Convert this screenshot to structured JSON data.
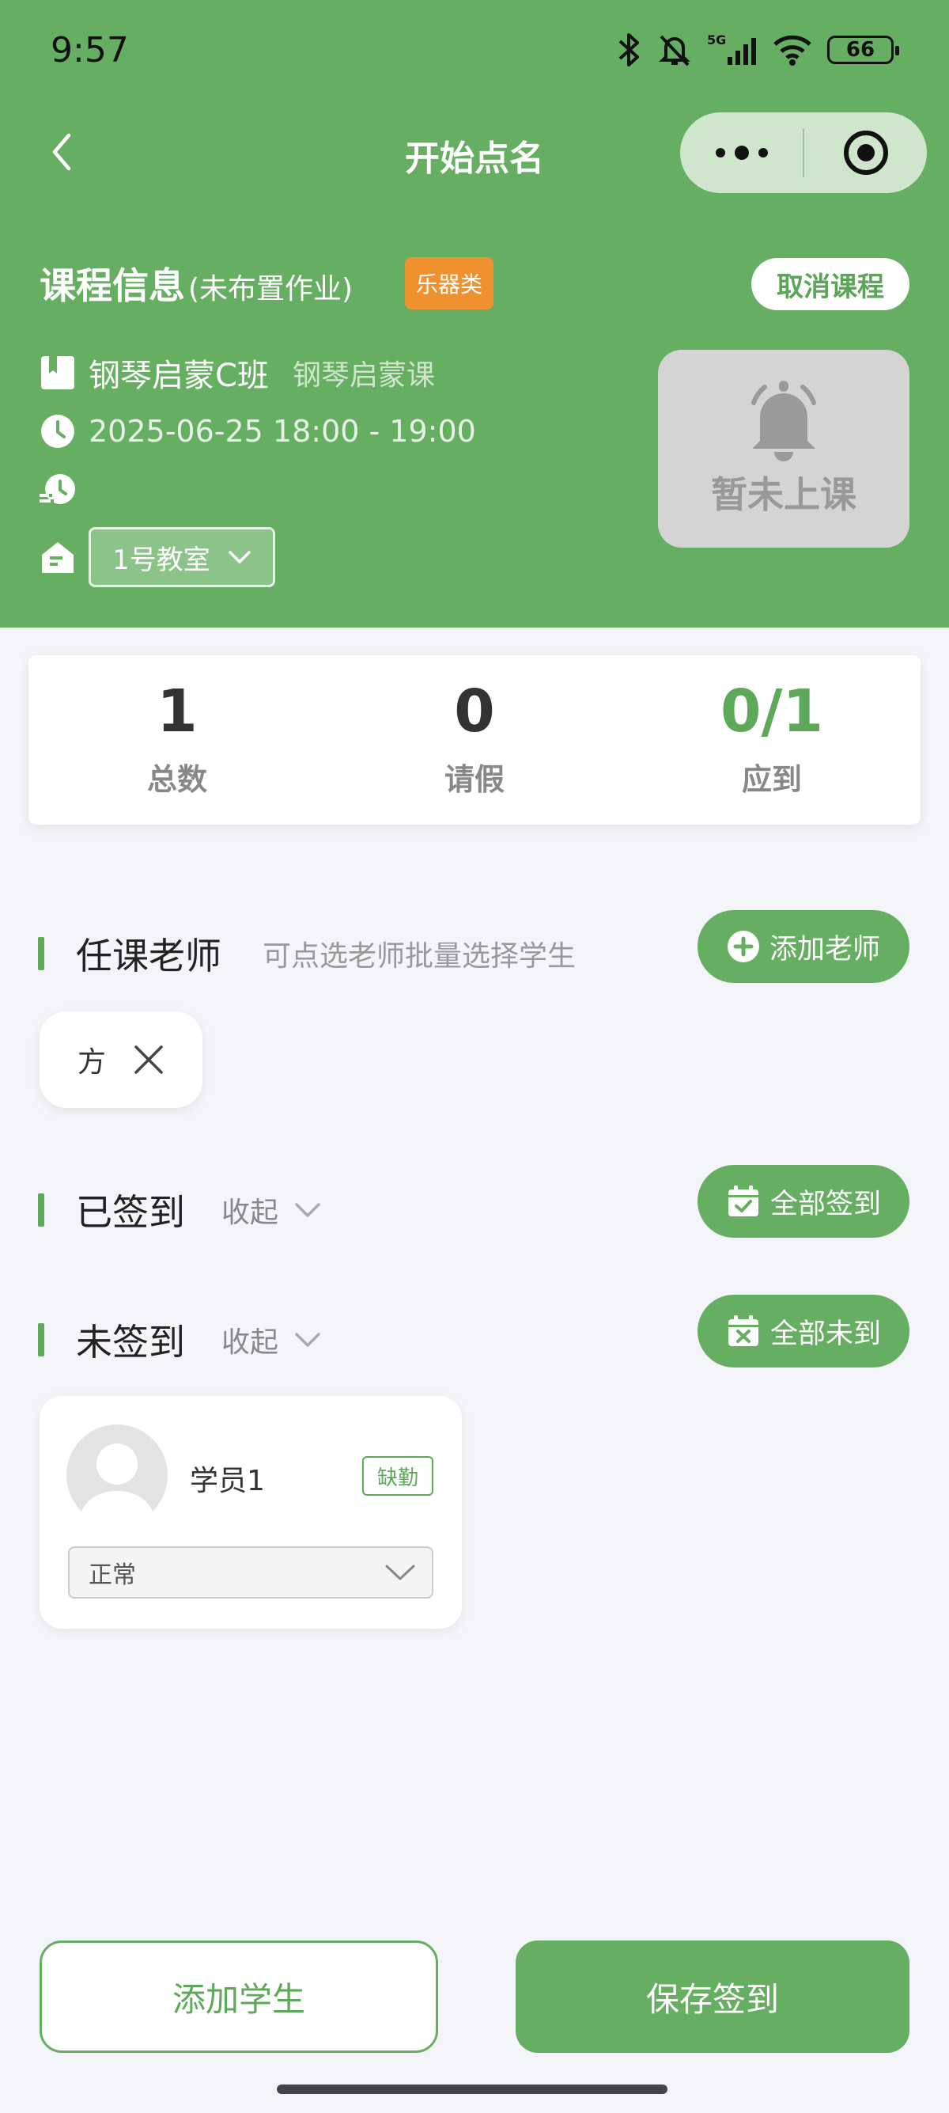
{
  "status_bar": {
    "time": "9:57",
    "network": "5G",
    "battery": "66"
  },
  "navbar": {
    "title": "开始点名"
  },
  "course": {
    "title": "课程信息",
    "note": "(未布置作业)",
    "category_tag": "乐器类",
    "cancel_label": "取消课程",
    "class_name": "钢琴启蒙C班",
    "course_name": "钢琴启蒙课",
    "datetime": "2025-06-25 18:00 - 19:00",
    "room": "1号教室",
    "class_status": "暂未上课"
  },
  "stats": [
    {
      "value": "1",
      "label": "总数"
    },
    {
      "value": "0",
      "label": "请假"
    },
    {
      "value": "0/1",
      "label": "应到"
    }
  ],
  "teachers": {
    "title": "任课老师",
    "hint": "可点选老师批量选择学生",
    "add_label": "添加老师",
    "items": [
      {
        "name": "方"
      }
    ]
  },
  "signed": {
    "title": "已签到",
    "collapse_label": "收起",
    "action_label": "全部签到"
  },
  "unsigned": {
    "title": "未签到",
    "collapse_label": "收起",
    "action_label": "全部未到",
    "students": [
      {
        "name": "学员1",
        "badge": "缺勤",
        "status": "正常"
      }
    ]
  },
  "footer": {
    "add_student_label": "添加学生",
    "save_label": "保存签到"
  },
  "colors": {
    "primary": "#66ae62",
    "orange_tag": "#f0912f",
    "background": "#f4f5f9"
  }
}
